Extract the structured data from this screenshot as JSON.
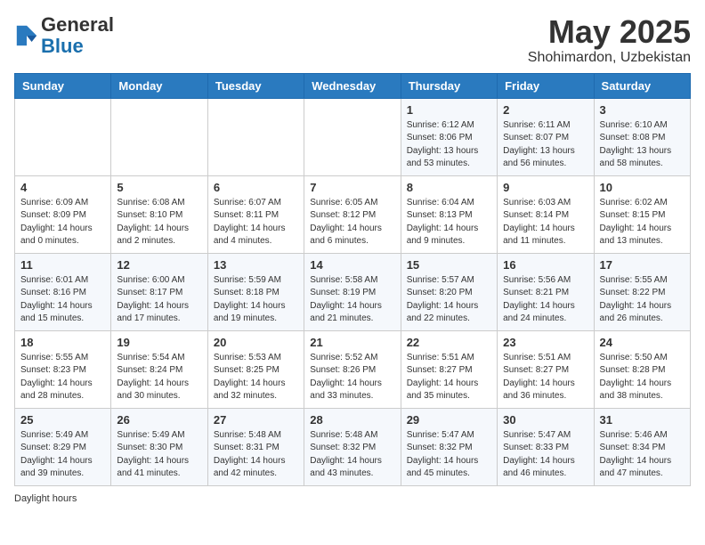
{
  "header": {
    "logo_general": "General",
    "logo_blue": "Blue",
    "month_title": "May 2025",
    "location": "Shohimardon, Uzbekistan"
  },
  "weekdays": [
    "Sunday",
    "Monday",
    "Tuesday",
    "Wednesday",
    "Thursday",
    "Friday",
    "Saturday"
  ],
  "weeks": [
    [
      {
        "day": "",
        "info": ""
      },
      {
        "day": "",
        "info": ""
      },
      {
        "day": "",
        "info": ""
      },
      {
        "day": "",
        "info": ""
      },
      {
        "day": "1",
        "info": "Sunrise: 6:12 AM\nSunset: 8:06 PM\nDaylight: 13 hours and 53 minutes."
      },
      {
        "day": "2",
        "info": "Sunrise: 6:11 AM\nSunset: 8:07 PM\nDaylight: 13 hours and 56 minutes."
      },
      {
        "day": "3",
        "info": "Sunrise: 6:10 AM\nSunset: 8:08 PM\nDaylight: 13 hours and 58 minutes."
      }
    ],
    [
      {
        "day": "4",
        "info": "Sunrise: 6:09 AM\nSunset: 8:09 PM\nDaylight: 14 hours and 0 minutes."
      },
      {
        "day": "5",
        "info": "Sunrise: 6:08 AM\nSunset: 8:10 PM\nDaylight: 14 hours and 2 minutes."
      },
      {
        "day": "6",
        "info": "Sunrise: 6:07 AM\nSunset: 8:11 PM\nDaylight: 14 hours and 4 minutes."
      },
      {
        "day": "7",
        "info": "Sunrise: 6:05 AM\nSunset: 8:12 PM\nDaylight: 14 hours and 6 minutes."
      },
      {
        "day": "8",
        "info": "Sunrise: 6:04 AM\nSunset: 8:13 PM\nDaylight: 14 hours and 9 minutes."
      },
      {
        "day": "9",
        "info": "Sunrise: 6:03 AM\nSunset: 8:14 PM\nDaylight: 14 hours and 11 minutes."
      },
      {
        "day": "10",
        "info": "Sunrise: 6:02 AM\nSunset: 8:15 PM\nDaylight: 14 hours and 13 minutes."
      }
    ],
    [
      {
        "day": "11",
        "info": "Sunrise: 6:01 AM\nSunset: 8:16 PM\nDaylight: 14 hours and 15 minutes."
      },
      {
        "day": "12",
        "info": "Sunrise: 6:00 AM\nSunset: 8:17 PM\nDaylight: 14 hours and 17 minutes."
      },
      {
        "day": "13",
        "info": "Sunrise: 5:59 AM\nSunset: 8:18 PM\nDaylight: 14 hours and 19 minutes."
      },
      {
        "day": "14",
        "info": "Sunrise: 5:58 AM\nSunset: 8:19 PM\nDaylight: 14 hours and 21 minutes."
      },
      {
        "day": "15",
        "info": "Sunrise: 5:57 AM\nSunset: 8:20 PM\nDaylight: 14 hours and 22 minutes."
      },
      {
        "day": "16",
        "info": "Sunrise: 5:56 AM\nSunset: 8:21 PM\nDaylight: 14 hours and 24 minutes."
      },
      {
        "day": "17",
        "info": "Sunrise: 5:55 AM\nSunset: 8:22 PM\nDaylight: 14 hours and 26 minutes."
      }
    ],
    [
      {
        "day": "18",
        "info": "Sunrise: 5:55 AM\nSunset: 8:23 PM\nDaylight: 14 hours and 28 minutes."
      },
      {
        "day": "19",
        "info": "Sunrise: 5:54 AM\nSunset: 8:24 PM\nDaylight: 14 hours and 30 minutes."
      },
      {
        "day": "20",
        "info": "Sunrise: 5:53 AM\nSunset: 8:25 PM\nDaylight: 14 hours and 32 minutes."
      },
      {
        "day": "21",
        "info": "Sunrise: 5:52 AM\nSunset: 8:26 PM\nDaylight: 14 hours and 33 minutes."
      },
      {
        "day": "22",
        "info": "Sunrise: 5:51 AM\nSunset: 8:27 PM\nDaylight: 14 hours and 35 minutes."
      },
      {
        "day": "23",
        "info": "Sunrise: 5:51 AM\nSunset: 8:27 PM\nDaylight: 14 hours and 36 minutes."
      },
      {
        "day": "24",
        "info": "Sunrise: 5:50 AM\nSunset: 8:28 PM\nDaylight: 14 hours and 38 minutes."
      }
    ],
    [
      {
        "day": "25",
        "info": "Sunrise: 5:49 AM\nSunset: 8:29 PM\nDaylight: 14 hours and 39 minutes."
      },
      {
        "day": "26",
        "info": "Sunrise: 5:49 AM\nSunset: 8:30 PM\nDaylight: 14 hours and 41 minutes."
      },
      {
        "day": "27",
        "info": "Sunrise: 5:48 AM\nSunset: 8:31 PM\nDaylight: 14 hours and 42 minutes."
      },
      {
        "day": "28",
        "info": "Sunrise: 5:48 AM\nSunset: 8:32 PM\nDaylight: 14 hours and 43 minutes."
      },
      {
        "day": "29",
        "info": "Sunrise: 5:47 AM\nSunset: 8:32 PM\nDaylight: 14 hours and 45 minutes."
      },
      {
        "day": "30",
        "info": "Sunrise: 5:47 AM\nSunset: 8:33 PM\nDaylight: 14 hours and 46 minutes."
      },
      {
        "day": "31",
        "info": "Sunrise: 5:46 AM\nSunset: 8:34 PM\nDaylight: 14 hours and 47 minutes."
      }
    ]
  ],
  "footer": {
    "daylight_label": "Daylight hours"
  }
}
